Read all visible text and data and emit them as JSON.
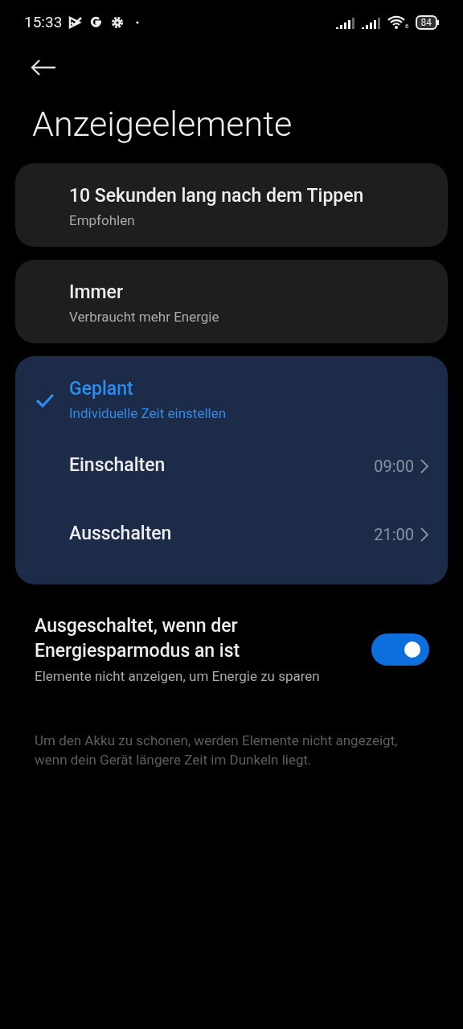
{
  "status_bar": {
    "time": "15:33",
    "wifi_label": "6",
    "battery": "84"
  },
  "title": "Anzeigeelemente",
  "options": [
    {
      "title": "10 Sekunden lang nach dem Tippen",
      "subtitle": "Empfohlen",
      "selected": false
    },
    {
      "title": "Immer",
      "subtitle": "Verbraucht mehr Energie",
      "selected": false
    },
    {
      "title": "Geplant",
      "subtitle": "Individuelle Zeit einstellen",
      "selected": true,
      "schedule": [
        {
          "label": "Einschalten",
          "value": "09:00"
        },
        {
          "label": "Ausschalten",
          "value": "21:00"
        }
      ]
    }
  ],
  "power_saving": {
    "title": "Ausgeschaltet, wenn der Energiesparmodus an ist",
    "subtitle": "Elemente nicht anzeigen, um Energie zu sparen",
    "on": true
  },
  "footer_note": "Um den Akku zu schonen, werden Elemente nicht angezeigt, wenn dein Gerät längere Zeit im Dunkeln liegt."
}
